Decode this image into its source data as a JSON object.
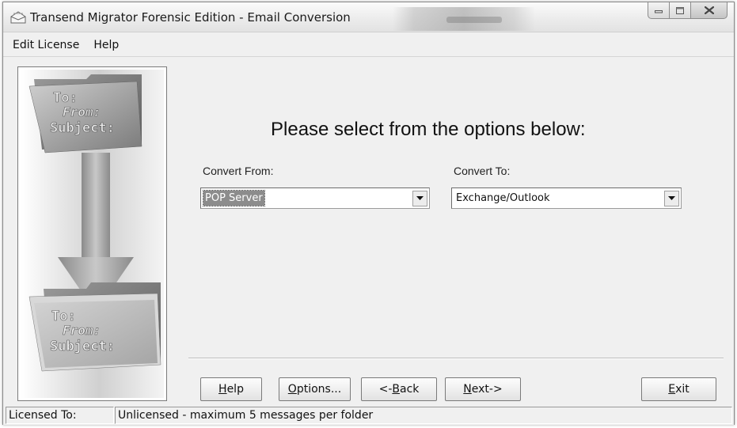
{
  "window": {
    "title": "Transend Migrator Forensic Edition - Email Conversion"
  },
  "menu": {
    "items": [
      "Edit License",
      "Help"
    ]
  },
  "graphic": {
    "top_lines": [
      "To:",
      "From:",
      "Subject:"
    ],
    "bottom_lines": [
      "To:",
      "From:",
      "Subject:"
    ]
  },
  "main": {
    "heading": "Please select from the options below:",
    "convert_from": {
      "label": "Convert From:",
      "selected": "POP Server"
    },
    "convert_to": {
      "label": "Convert To:",
      "selected": "Exchange/Outlook"
    }
  },
  "buttons": {
    "help": {
      "pre": "",
      "accel": "H",
      "post": "elp"
    },
    "options": {
      "pre": "",
      "accel": "O",
      "post": "ptions..."
    },
    "back": {
      "pre": "<-",
      "accel": "B",
      "post": "ack"
    },
    "next": {
      "pre": "",
      "accel": "N",
      "post": "ext->"
    },
    "exit": {
      "pre": "",
      "accel": "E",
      "post": "xit"
    }
  },
  "status": {
    "label": "Licensed To:",
    "value": "Unlicensed - maximum 5 messages per folder"
  },
  "icons": {
    "app": "envelope-icon",
    "combo_arrow": "chevron-down-icon",
    "minimize": "minimize-icon",
    "maximize": "maximize-icon",
    "close": "close-icon"
  }
}
